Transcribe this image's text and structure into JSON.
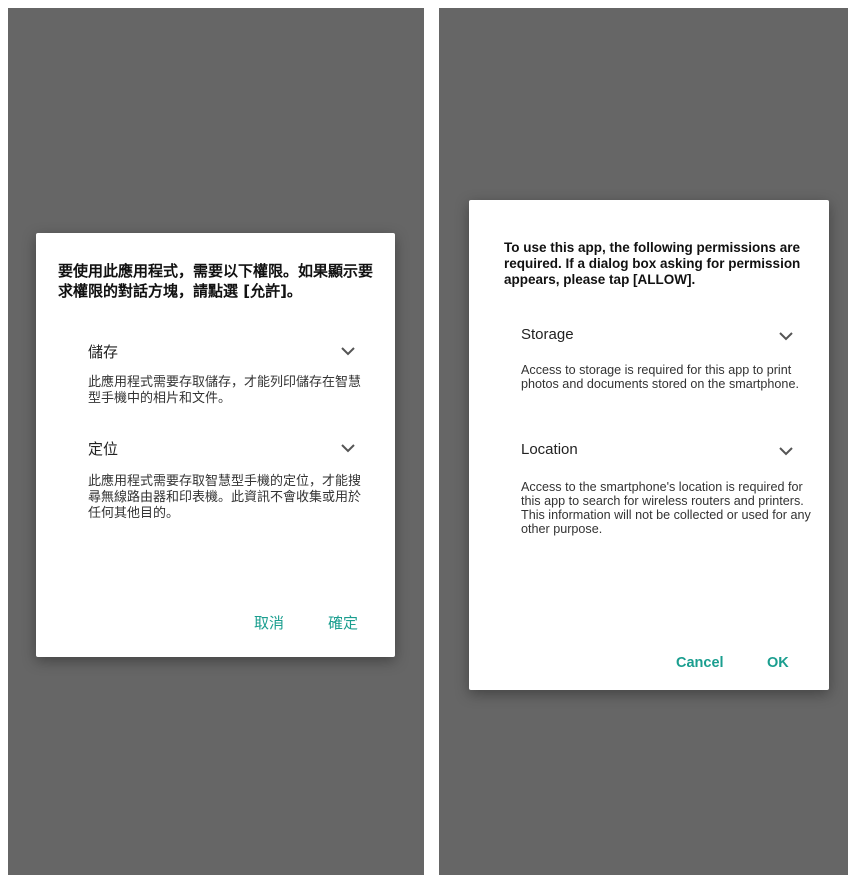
{
  "colors": {
    "background": "#666666",
    "dialog": "#ffffff",
    "accent": "#1a9e8f"
  },
  "zh": {
    "title": "要使用此應用程式，需要以下權限。如果顯示要求權限的對話方塊，請點選 [允許]。",
    "sections": [
      {
        "label": "儲存",
        "icon": "chevron-down-icon",
        "description": "此應用程式需要存取儲存，才能列印儲存在智慧型手機中的相片和文件。"
      },
      {
        "label": "定位",
        "icon": "chevron-down-icon",
        "description": "此應用程式需要存取智慧型手機的定位，才能搜尋無線路由器和印表機。此資訊不會收集或用於任何其他目的。"
      }
    ],
    "cancel_label": "取消",
    "ok_label": "確定"
  },
  "en": {
    "title": "To use this app, the following permissions are required. If a dialog box asking for permission appears, please tap [ALLOW].",
    "sections": [
      {
        "label": "Storage",
        "icon": "chevron-down-icon",
        "description": "Access to storage is required for this app to print photos and documents stored on the smartphone."
      },
      {
        "label": "Location",
        "icon": "chevron-down-icon",
        "description": "Access to the smartphone's location is required for this app to search for wireless routers and printers. This information will not be collected or used for any other purpose."
      }
    ],
    "cancel_label": "Cancel",
    "ok_label": "OK"
  }
}
